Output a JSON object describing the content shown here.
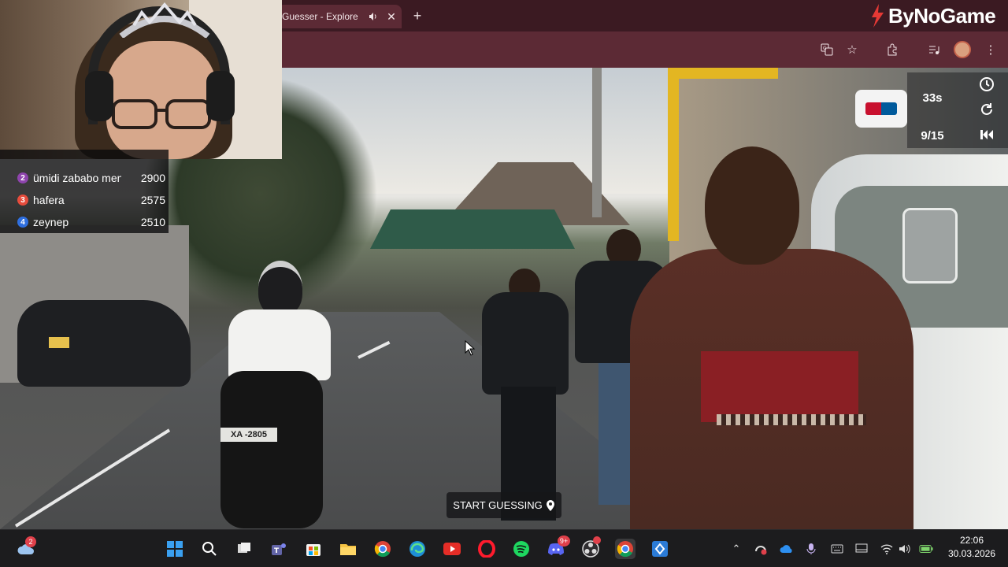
{
  "browser": {
    "tab_title": "Guesser - Explore",
    "brand_text": "ByNoGame"
  },
  "game": {
    "timer": "33s",
    "round": "9/15",
    "start_button_label": "START GUESSING",
    "plate_text": "XA -2805"
  },
  "leaderboard": {
    "rows": [
      {
        "rank": "2",
        "name": "ümidi zababo men",
        "score": "2900",
        "color": "#8e44ad"
      },
      {
        "rank": "3",
        "name": "hafera",
        "score": "2575",
        "color": "#e74c3c"
      },
      {
        "rank": "4",
        "name": "zeynep",
        "score": "2510",
        "color": "#2f6fdf"
      }
    ]
  },
  "taskbar": {
    "weather_badge": "2",
    "discord_badge": "9+",
    "time": "22:06",
    "date": "30.03.2026"
  },
  "colors": {
    "tab_bar": "#3b1a22",
    "toolbar": "#5c2a35",
    "taskbar": "#1c1c1e"
  }
}
